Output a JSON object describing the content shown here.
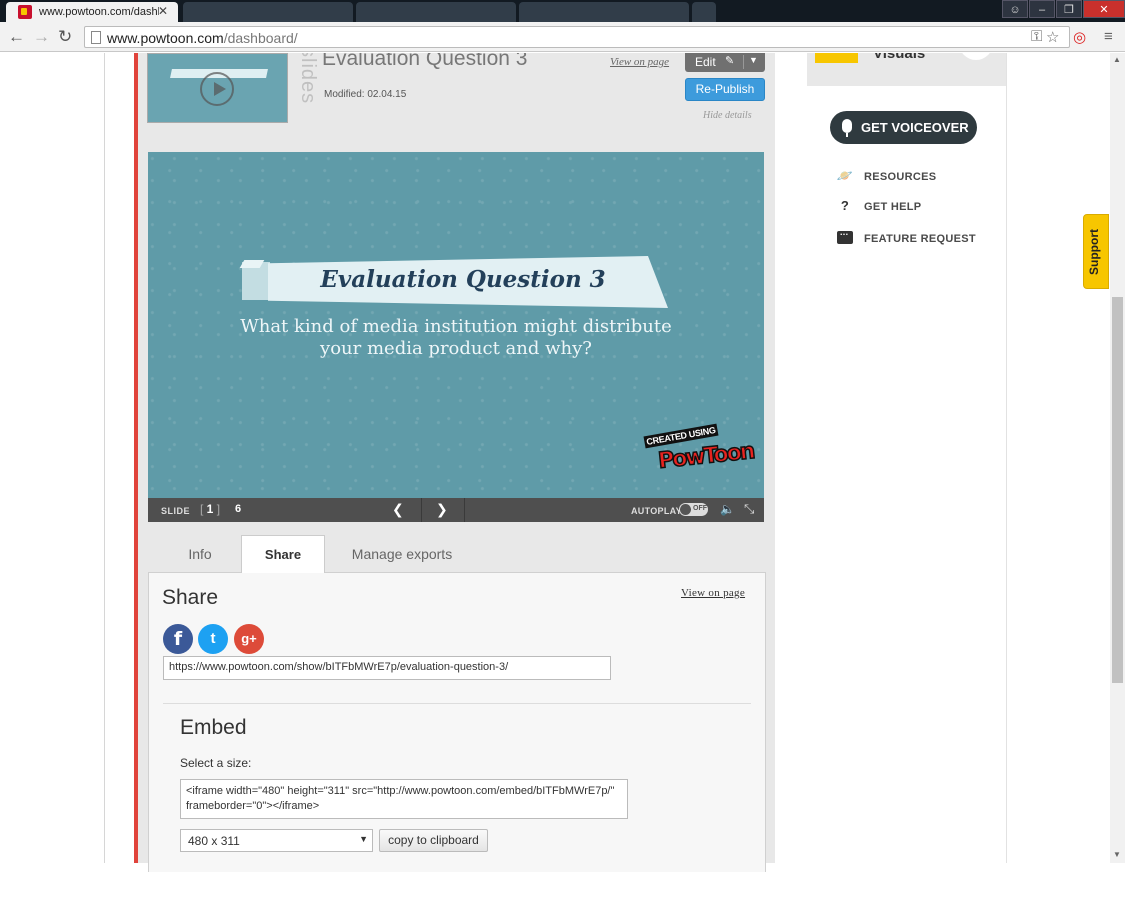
{
  "browser": {
    "tab_title": "www.powtoon.com/dashb",
    "url_host": "www.powtoon.com",
    "url_path": "/dashboard/"
  },
  "powtoon": {
    "title": "Evaluation Question 3",
    "slides_label": "slides",
    "modified": "Modified: 02.04.15",
    "view_on_page": "View on page",
    "edit_label": "Edit",
    "republish_label": "Re-Publish",
    "hide_details": "Hide details"
  },
  "slide": {
    "title": "Evaluation Question 3",
    "subtitle_line1": "What kind of media institution might distribute",
    "subtitle_line2": "your media product and why?",
    "created_using": "CREATED USING",
    "logo": "PowToon"
  },
  "player": {
    "slide_label": "SLIDE",
    "current_slide": "1",
    "total_slides": "6",
    "autoplay_label": "AUTOPLAY",
    "autoplay_state": "OFF"
  },
  "tabs": [
    {
      "label": "Info"
    },
    {
      "label": "Share"
    },
    {
      "label": "Manage exports"
    }
  ],
  "share": {
    "title": "Share",
    "view_on_page": "View on page",
    "url": "https://www.powtoon.com/show/bITFbMWrE7p/evaluation-question-3/",
    "embed_title": "Embed",
    "size_label": "Select a size:",
    "embed_code": "<iframe width=\"480\" height=\"311\" src=\"http://www.powtoon.com/embed/bITFbMWrE7p/\" frameborder=\"0\"></iframe>",
    "selected_size": "480 x 311",
    "copy_label": "copy to clipboard"
  },
  "sidebar": {
    "card_text": "Visuals",
    "voiceover": "GET VOICEOVER",
    "links": [
      {
        "label": "RESOURCES"
      },
      {
        "label": "GET HELP"
      },
      {
        "label": "FEATURE REQUEST"
      }
    ],
    "support": "Support"
  },
  "colors": {
    "accent_blue": "#3d9bdc",
    "player_bg": "#5f9ba8",
    "red_bar": "#e0433b",
    "support_yellow": "#f7c600"
  }
}
